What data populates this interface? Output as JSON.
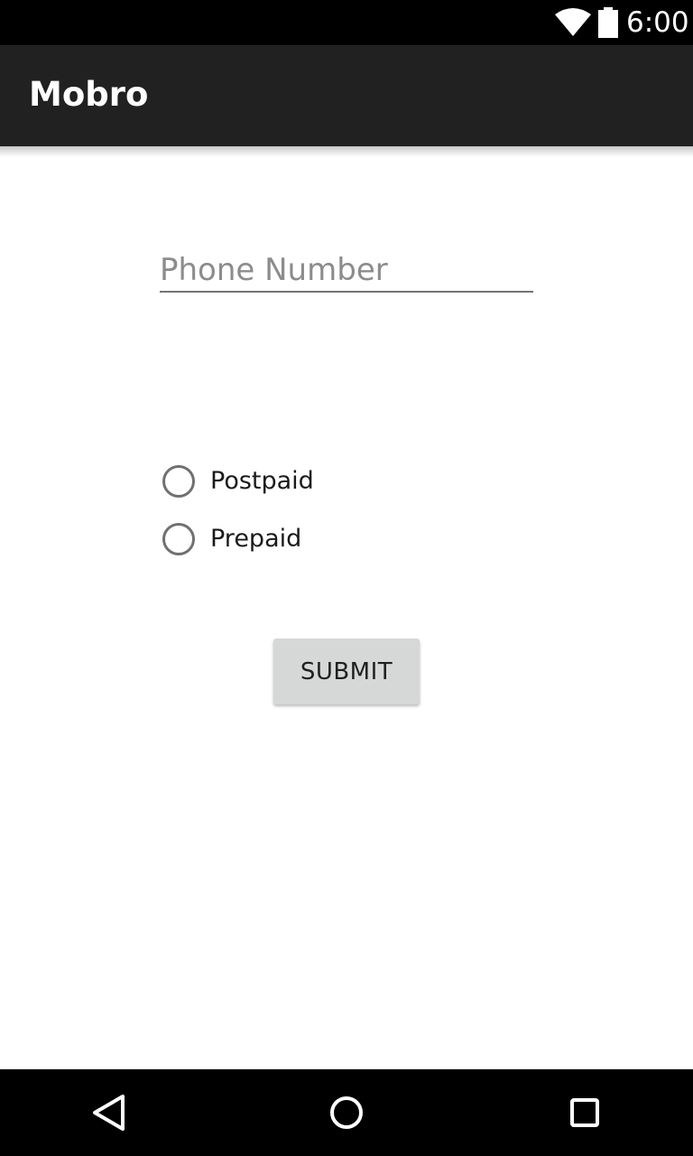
{
  "status_bar": {
    "time": "6:00",
    "icons": [
      "wifi-icon",
      "battery-icon"
    ]
  },
  "app_bar": {
    "title": "Mobro"
  },
  "form": {
    "phone_placeholder": "Phone Number",
    "phone_value": "",
    "plan_options": [
      {
        "label": "Postpaid",
        "selected": false
      },
      {
        "label": "Prepaid",
        "selected": false
      }
    ],
    "submit_label": "SUBMIT"
  },
  "nav_bar": {
    "buttons": [
      "back-icon",
      "home-icon",
      "recents-icon"
    ]
  },
  "colors": {
    "status_bar": "#000000",
    "app_bar": "#212121",
    "button": "#d6d7d7",
    "nav_bar": "#000000"
  }
}
